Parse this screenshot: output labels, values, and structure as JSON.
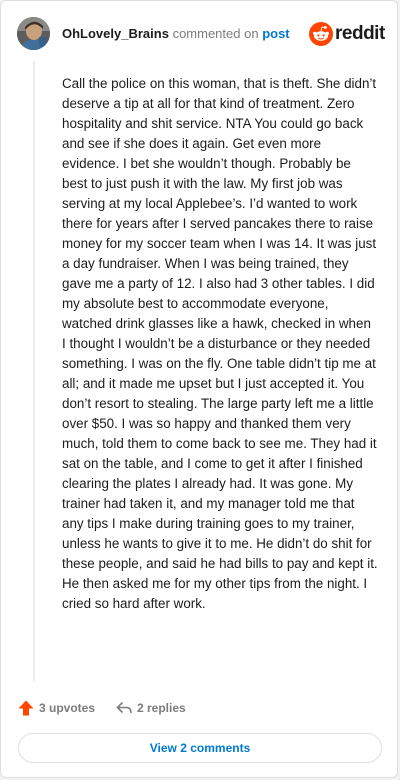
{
  "comment": {
    "username": "OhLovely_Brains",
    "action_text": "commented on",
    "post_link": "post",
    "brand": "reddit",
    "body": "Call the police on this woman, that is theft. She didn’t deserve a tip at all for that kind of treatment. Zero hospitality and shit service. NTA You could go back and see if she does it again. Get even more evidence. I bet she wouldn’t though. Probably be best to just push it with the law. My first job was serving at my local Applebee’s. I’d wanted to work there for years after I served pancakes there to raise money for my soccer team when I was 14. It was just a day fundraiser. When I was being trained, they gave me a party of 12. I also had 3 other tables. I did my absolute best to accommodate everyone, watched drink glasses like a hawk, checked in when I thought I wouldn’t be a disturbance or they needed something. I was on the fly. One table didn’t tip me at all; and it made me upset but I just accepted it. You don’t resort to stealing. The large party left me a little over $50. I was so happy and thanked them very much, told them to come back to see me. They had it sat on the table, and I come to get it after I finished clearing the plates I already had. It was gone. My trainer had taken it, and my manager told me that any tips I make during training goes to my trainer, unless he wants to give it to me. He didn’t do shit for these people, and said he had bills to pay and kept it. He then asked me for my other tips from the night. I cried so hard after work.",
    "upvotes_label": "3 upvotes",
    "replies_label": "2 replies",
    "view_comments_label": "View 2 comments"
  },
  "icons": {
    "avatar": "avatar",
    "brand": "reddit-snoo-icon",
    "upvote": "upvote-arrow-icon",
    "reply": "reply-arrow-icon"
  },
  "colors": {
    "brand_orange": "#ff4500",
    "link_blue": "#0079d3",
    "muted_gray": "#7c7c7c",
    "text": "#1c1c1c"
  }
}
